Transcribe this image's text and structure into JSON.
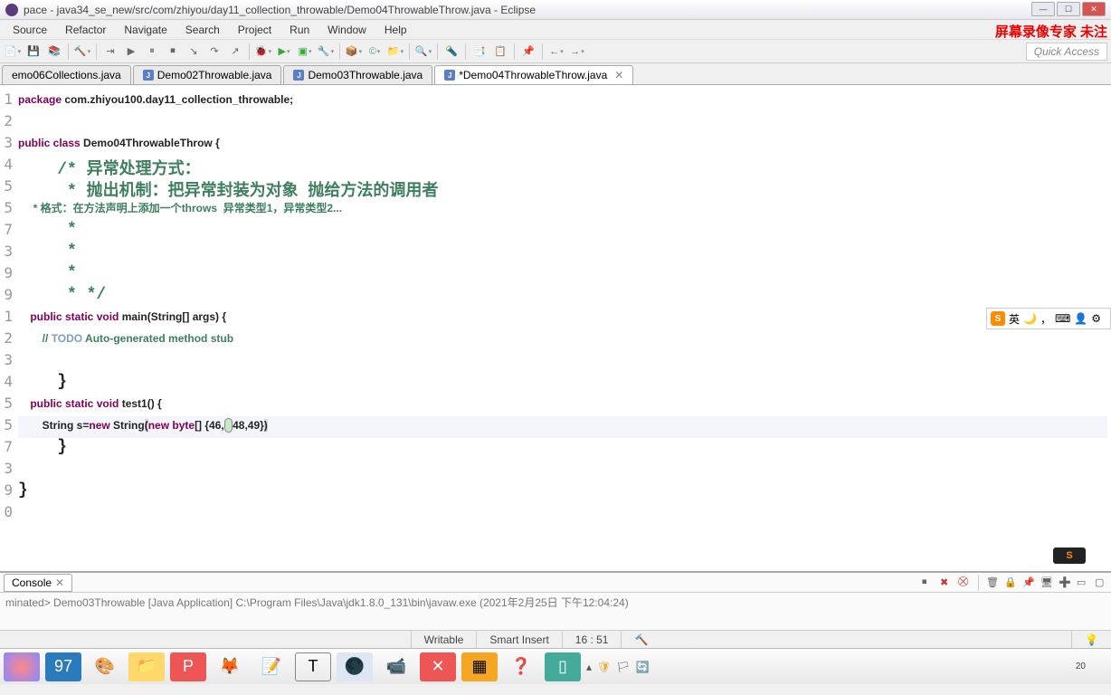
{
  "title": "pace - java34_se_new/src/com/zhiyou/day11_collection_throwable/Demo04ThrowableThrow.java - Eclipse",
  "watermark": "屏幕录像专家 未注",
  "menu": [
    "Source",
    "Refactor",
    "Navigate",
    "Search",
    "Project",
    "Run",
    "Window",
    "Help"
  ],
  "quick_access": "Quick Access",
  "tabs": [
    {
      "label": "emo06Collections.java",
      "active": false
    },
    {
      "label": "Demo02Throwable.java",
      "active": false
    },
    {
      "label": "Demo03Throwable.java",
      "active": false
    },
    {
      "label": "*Demo04ThrowableThrow.java",
      "active": true
    }
  ],
  "line_numbers": [
    "1",
    "2",
    "3",
    "4",
    "5",
    "5",
    "7",
    "3",
    "9",
    "9",
    "1",
    "2",
    "3",
    "4",
    "5",
    "5",
    "7",
    "3",
    "9",
    "0"
  ],
  "code": {
    "l1": {
      "p1": "package",
      "p2": " com.zhiyou100.day11_collection_throwable;"
    },
    "l3": {
      "p1": "public",
      "p2": " class",
      "p3": " Demo04ThrowableThrow {"
    },
    "l4": "    /* 异常处理方式：",
    "l5": "     * 抛出机制：把异常封装为对象 抛给方法的调用者",
    "l6a": "     * 格式：在方法声明上添加一个",
    "l6b": "throws  异常类型1，异常类型2...",
    "l7": "     *",
    "l8": "     *",
    "l9": "     *",
    "l10": "     * */",
    "l11": {
      "p1": "    public",
      "p2": " static",
      "p3": " void",
      "p4": " main(String[] args) {"
    },
    "l12": {
      "p1": "        // ",
      "p2": "TODO",
      "p3": " Auto-generated method stub"
    },
    "l14": "    }",
    "l15": {
      "p1": "    public",
      "p2": " static",
      "p3": " void",
      "p4": " test1() {"
    },
    "l16": {
      "p1": "        String s=",
      "p2": "new",
      "p3": " String",
      "paren": "(",
      "p4": "new",
      "p5": " byte",
      "p6": "[] {46,",
      "cursor": " ",
      "p7": "48,49}",
      ")": ")"
    },
    "l17": "    }",
    "l19": "}"
  },
  "ime": {
    "lang": "英"
  },
  "console": {
    "tab": "Console",
    "status": "minated> Demo03Throwable [Java Application] C:\\Program Files\\Java\\jdk1.8.0_131\\bin\\javaw.exe (2021年2月25日 下午12:04:24)"
  },
  "status": {
    "writable": "Writable",
    "insert": "Smart Insert",
    "pos": "16 : 51"
  },
  "taskbar_time": "20"
}
